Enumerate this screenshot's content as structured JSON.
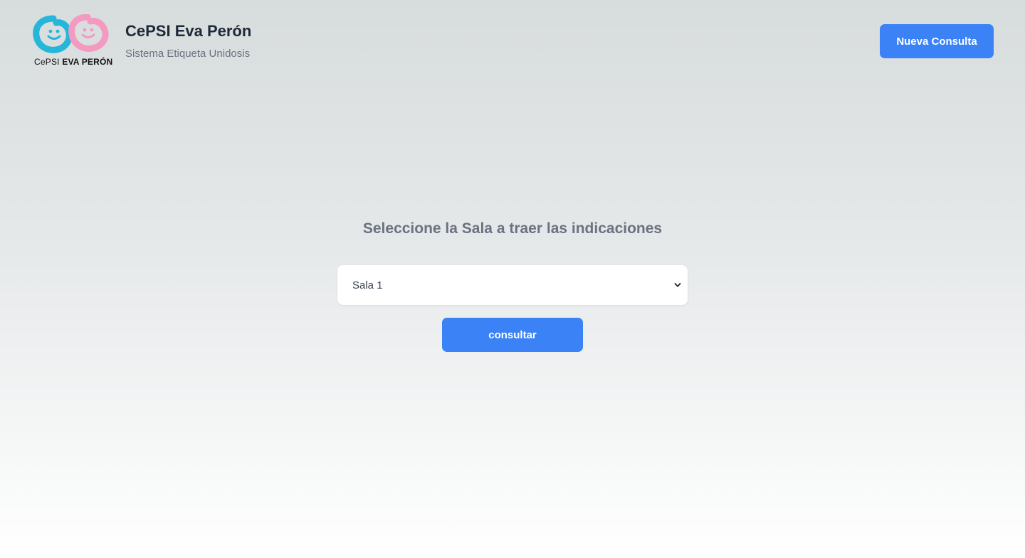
{
  "header": {
    "logo": {
      "icon": "twin-smiley-faces-logo",
      "caption_light": "CePSI",
      "caption_bold": "EVA PERÓN",
      "colors": {
        "left_face": "#25b6d9",
        "right_face": "#f49ac1"
      }
    },
    "title": "CePSI Eva Perón",
    "subtitle": "Sistema Etiqueta Unidosis",
    "new_query_label": "Nueva Consulta"
  },
  "main": {
    "prompt": "Seleccione la Sala a traer las indicaciones",
    "sala_select": {
      "selected": "Sala 1",
      "icon": "chevron-down-icon"
    },
    "consult_label": "consultar"
  },
  "colors": {
    "accent": "#3b82f6",
    "title_text": "#1f2937",
    "muted_text": "#6b7280",
    "background_top": "#d7dcdd",
    "background_bottom": "#ffffff"
  }
}
